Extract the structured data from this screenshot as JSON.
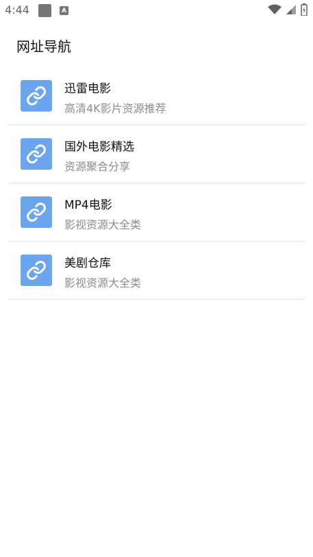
{
  "status_bar": {
    "time": "4:44",
    "notif_a_letter": "A"
  },
  "page": {
    "title": "网址导航"
  },
  "items": [
    {
      "title": "迅雷电影",
      "subtitle": "高清4K影片资源推荐"
    },
    {
      "title": "国外电影精选",
      "subtitle": "资源聚合分享"
    },
    {
      "title": "MP4电影",
      "subtitle": "影视资源大全类"
    },
    {
      "title": "美剧仓库",
      "subtitle": "影视资源大全类"
    }
  ],
  "colors": {
    "icon_bg": "#6aa5ee",
    "divider": "#e2e2e2",
    "subtitle": "#8c8c8c"
  },
  "icons": {
    "item_icon": "link-icon"
  }
}
